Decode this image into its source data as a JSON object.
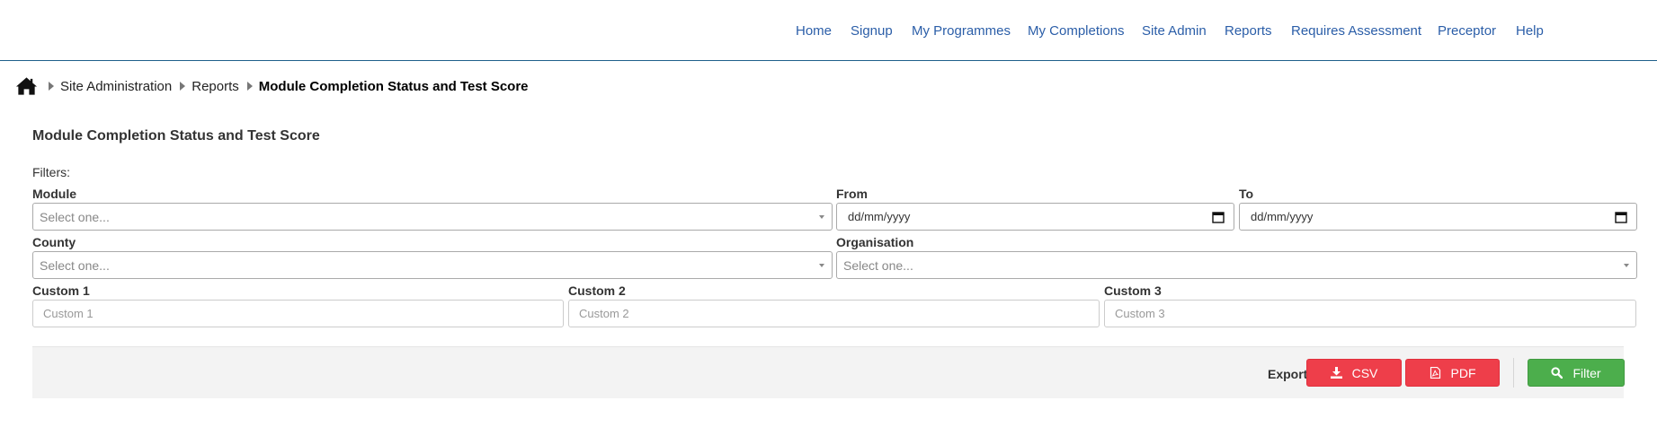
{
  "nav": {
    "items": [
      {
        "label": "Home"
      },
      {
        "label": "Signup"
      },
      {
        "label": "My Programmes"
      },
      {
        "label": "My Completions"
      },
      {
        "label": "Site Admin"
      },
      {
        "label": "Reports"
      },
      {
        "label": "Requires Assessment"
      },
      {
        "label": "Preceptor"
      },
      {
        "label": "Help"
      }
    ],
    "link_color": "#2b5ea8"
  },
  "breadcrumb": {
    "items": [
      {
        "label": "Site Administration"
      },
      {
        "label": "Reports"
      }
    ],
    "current": "Module Completion Status and Test Score"
  },
  "page": {
    "title": "Module Completion Status and Test Score",
    "filters_label": "Filters:"
  },
  "filters": {
    "module": {
      "label": "Module",
      "placeholder": "Select one..."
    },
    "from": {
      "label": "From",
      "placeholder": "dd/mm/yyyy"
    },
    "to": {
      "label": "To",
      "placeholder": "dd/mm/yyyy"
    },
    "county": {
      "label": "County",
      "placeholder": "Select one..."
    },
    "organisation": {
      "label": "Organisation",
      "placeholder": "Select one..."
    },
    "custom1": {
      "label": "Custom 1",
      "placeholder": "Custom 1"
    },
    "custom2": {
      "label": "Custom 2",
      "placeholder": "Custom 2"
    },
    "custom3": {
      "label": "Custom 3",
      "placeholder": "Custom 3"
    }
  },
  "actions": {
    "export_label": "Export:",
    "csv_label": "CSV",
    "pdf_label": "PDF",
    "filter_label": "Filter",
    "export_color": "#ee3e4a",
    "filter_color": "#4cae4c"
  }
}
